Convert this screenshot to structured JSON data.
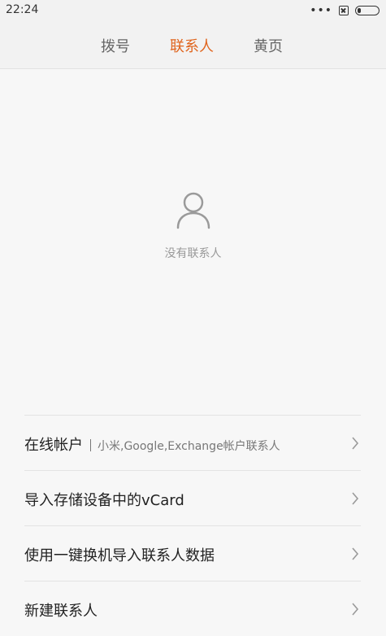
{
  "status_bar": {
    "time": "22:24",
    "icons": [
      "more-dots-icon",
      "no-sim-icon",
      "battery-icon"
    ]
  },
  "tabs": [
    {
      "label": "拨号",
      "active": false
    },
    {
      "label": "联系人",
      "active": true
    },
    {
      "label": "黄页",
      "active": false
    }
  ],
  "colors": {
    "active_tab": "#e0651e",
    "text_primary": "#222222",
    "text_secondary": "#999999",
    "background": "#f7f7f7",
    "divider": "#e3e3e3"
  },
  "empty_state": {
    "icon": "person-icon",
    "text": "没有联系人"
  },
  "options": [
    {
      "label": "在线帐户",
      "sublabel": "小米,Google,Exchange帐户联系人"
    },
    {
      "label": "导入存储设备中的vCard"
    },
    {
      "label": "使用一键换机导入联系人数据"
    },
    {
      "label": "新建联系人"
    }
  ]
}
